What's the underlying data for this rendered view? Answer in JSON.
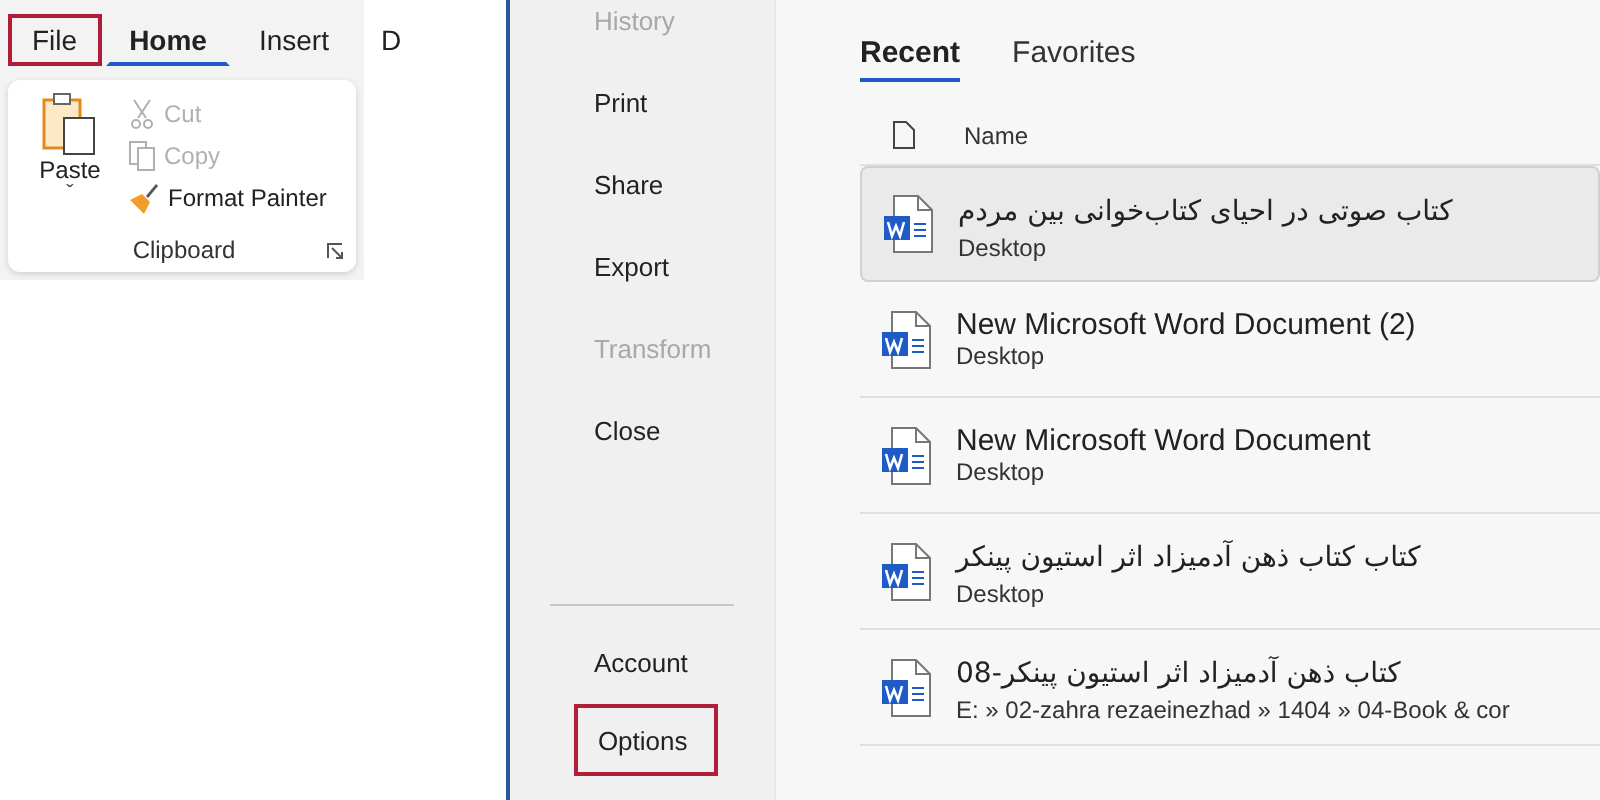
{
  "ribbon": {
    "tabs": [
      {
        "label": "File",
        "selected": false,
        "highlighted": true
      },
      {
        "label": "Home",
        "selected": true,
        "highlighted": false
      },
      {
        "label": "Insert",
        "selected": false,
        "highlighted": false
      },
      {
        "label": "D",
        "selected": false,
        "highlighted": false
      }
    ],
    "clipboard": {
      "paste": "Paste",
      "paste_caret": "ˇ",
      "items": [
        {
          "label": "Cut",
          "kind": "cut",
          "disabled": true
        },
        {
          "label": "Copy",
          "kind": "copy",
          "disabled": true
        },
        {
          "label": "Format Painter",
          "kind": "painter",
          "disabled": false
        }
      ],
      "group_label": "Clipboard"
    }
  },
  "backstage_menu": {
    "items": [
      {
        "label": "History",
        "disabled": true,
        "highlighted": false
      },
      {
        "label": "Print",
        "disabled": false,
        "highlighted": false
      },
      {
        "label": "Share",
        "disabled": false,
        "highlighted": false
      },
      {
        "label": "Export",
        "disabled": false,
        "highlighted": false
      },
      {
        "label": "Transform",
        "disabled": true,
        "highlighted": false
      },
      {
        "label": "Close",
        "disabled": false,
        "highlighted": false
      }
    ],
    "bottom_items": [
      {
        "label": "Account",
        "disabled": false,
        "highlighted": false
      },
      {
        "label": "Options",
        "disabled": false,
        "highlighted": true
      }
    ]
  },
  "recent": {
    "tabs": [
      {
        "label": "Recent",
        "selected": true
      },
      {
        "label": "Favorites",
        "selected": false
      }
    ],
    "column": "Name",
    "files": [
      {
        "name": "کتاب صوتی در احیای کتاب‌خوانی بین مردم",
        "rtl": true,
        "location": "Desktop",
        "selected": true
      },
      {
        "name": "New Microsoft Word Document (2)",
        "rtl": false,
        "location": "Desktop",
        "selected": false
      },
      {
        "name": "New Microsoft Word Document",
        "rtl": false,
        "location": "Desktop",
        "selected": false
      },
      {
        "name": "کتاب کتاب ذهن آدمیزاد اثر استیون پینکر",
        "rtl": true,
        "location": "Desktop",
        "selected": false
      },
      {
        "name": "کتاب ذهن آدمیزاد اثر استیون پینکر-08",
        "rtl": true,
        "location": "E: » 02-zahra rezaeinezhad » 1404 » 04-Book & cor",
        "selected": false
      }
    ]
  }
}
